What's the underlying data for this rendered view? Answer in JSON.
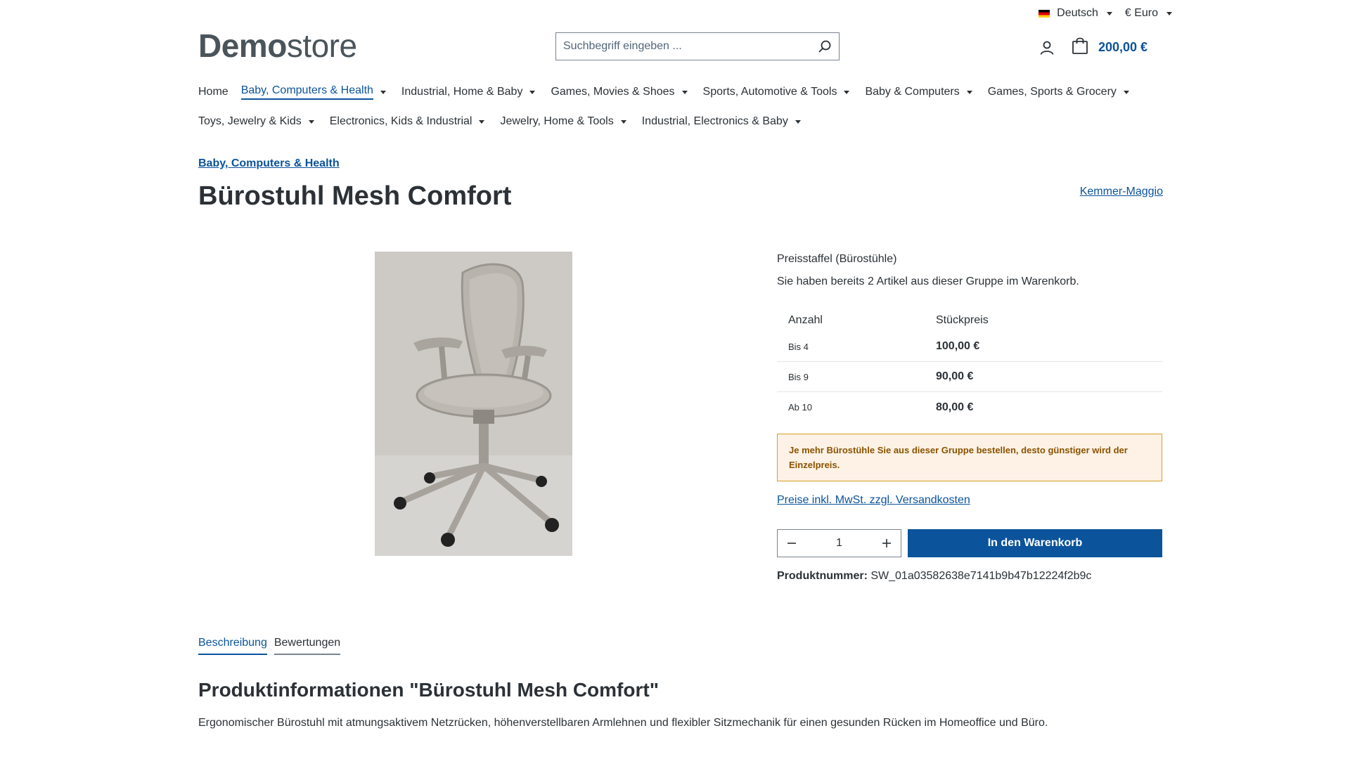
{
  "topbar": {
    "language": "Deutsch",
    "currency": "€ Euro"
  },
  "header": {
    "logo_bold": "Demo",
    "logo_light": "store",
    "search_placeholder": "Suchbegriff eingeben ...",
    "cart_total": "200,00 €"
  },
  "nav": {
    "items": [
      {
        "label": "Home"
      },
      {
        "label": "Baby, Computers & Health"
      },
      {
        "label": "Industrial, Home & Baby"
      },
      {
        "label": "Games, Movies & Shoes"
      },
      {
        "label": "Sports, Automotive & Tools"
      },
      {
        "label": "Baby & Computers"
      },
      {
        "label": "Games, Sports & Grocery"
      },
      {
        "label": "Toys, Jewelry & Kids"
      },
      {
        "label": "Electronics, Kids & Industrial"
      },
      {
        "label": "Jewelry, Home & Tools"
      },
      {
        "label": "Industrial, Electronics & Baby"
      }
    ]
  },
  "product": {
    "breadcrumb": "Baby, Computers & Health",
    "title": "Bürostuhl Mesh Comfort",
    "manufacturer": "Kemmer-Maggio",
    "price_group": "Preisstaffel (Bürostühle)",
    "group_info": "Sie haben bereits 2 Artikel aus dieser Gruppe im Warenkorb.",
    "price_table": {
      "col_quantity": "Anzahl",
      "col_unit_price": "Stückpreis",
      "rows": [
        {
          "qty": "Bis 4",
          "price": "100,00 €"
        },
        {
          "qty": "Bis 9",
          "price": "90,00 €"
        },
        {
          "qty": "Ab 10",
          "price": "80,00 €"
        }
      ]
    },
    "alert": "Je mehr Bürostühle Sie aus dieser Gruppe bestellen, desto günstiger wird der Einzelpreis.",
    "tax_link": "Preise inkl. MwSt. zzgl. Versandkosten",
    "quantity": "1",
    "add_to_cart": "In den Warenkorb",
    "product_number_label": "Produktnummer:",
    "product_number": "SW_01a03582638e7141b9b47b12224f2b9c"
  },
  "tabs": {
    "description": "Beschreibung",
    "reviews": "Bewertungen"
  },
  "description": {
    "title": "Produktinformationen \"Bürostuhl Mesh Comfort\"",
    "text": "Ergonomischer Bürostuhl mit atmungsaktivem Netzrücken, höhenverstellbaren Armlehnen und flexibler Sitzmechanik für einen gesunden Rücken im Homeoffice und Büro."
  },
  "colors": {
    "primary": "#0b539b",
    "text": "#2b3136",
    "alert_border": "#d59e28",
    "alert_bg": "#fdf2e5"
  },
  "icons": {
    "search": "search-icon",
    "account": "user-icon",
    "cart": "shopping-bag-icon",
    "minus": "minus-icon",
    "plus": "plus-icon"
  }
}
